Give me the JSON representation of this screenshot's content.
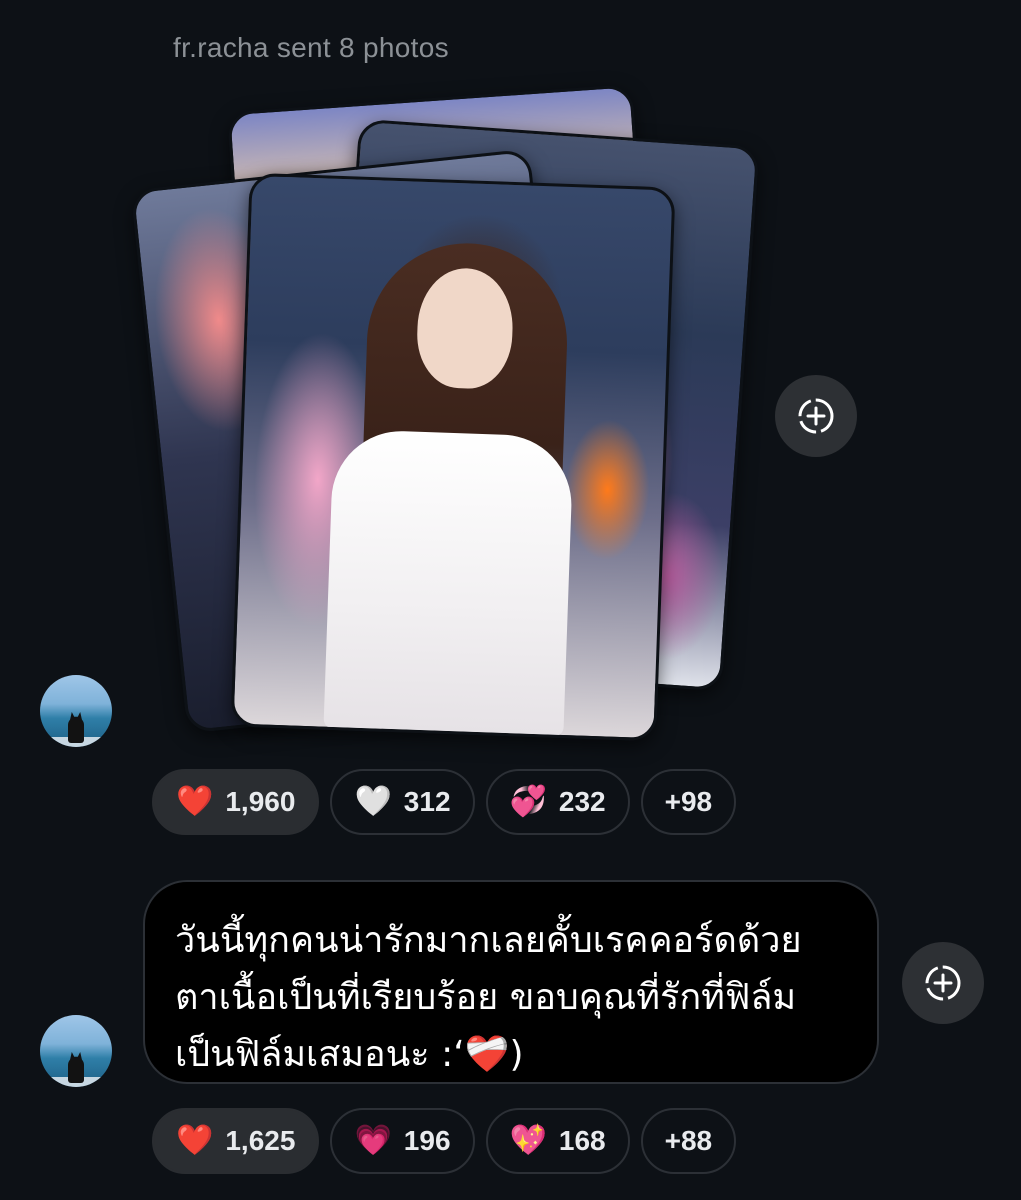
{
  "header": {
    "sender_label": "fr.racha sent 8 photos"
  },
  "photo_message": {
    "photo_count": 8,
    "add_reaction_icon": "add-reaction-icon",
    "reactions": [
      {
        "emoji": "❤️",
        "count": "1,960",
        "active": true
      },
      {
        "emoji": "🤍",
        "count": "312",
        "active": false
      },
      {
        "emoji": "💞",
        "count": "232",
        "active": false
      },
      {
        "emoji": "",
        "count": "+98",
        "active": false
      }
    ]
  },
  "text_message": {
    "lines": [
      "วันนี้ทุกคนน่ารักมากเลยคั้บเรคคอร์ดด้วย",
      "ตาเนื้อเป็นที่เรียบร้อย ขอบคุณที่รักที่ฟิล์ม",
      "เป็นฟิล์มเสมอนะ  :‘❤️‍🩹)"
    ],
    "reactions": [
      {
        "emoji": "❤️",
        "count": "1,625",
        "active": true
      },
      {
        "emoji": "💗",
        "count": "196",
        "active": false
      },
      {
        "emoji": "💖",
        "count": "168",
        "active": false
      },
      {
        "emoji": "",
        "count": "+88",
        "active": false
      }
    ]
  },
  "colors": {
    "background": "#0d1116",
    "pill_active": "#2a2d31",
    "pill_border": "#2c3036",
    "sender_text": "#8c9196"
  }
}
